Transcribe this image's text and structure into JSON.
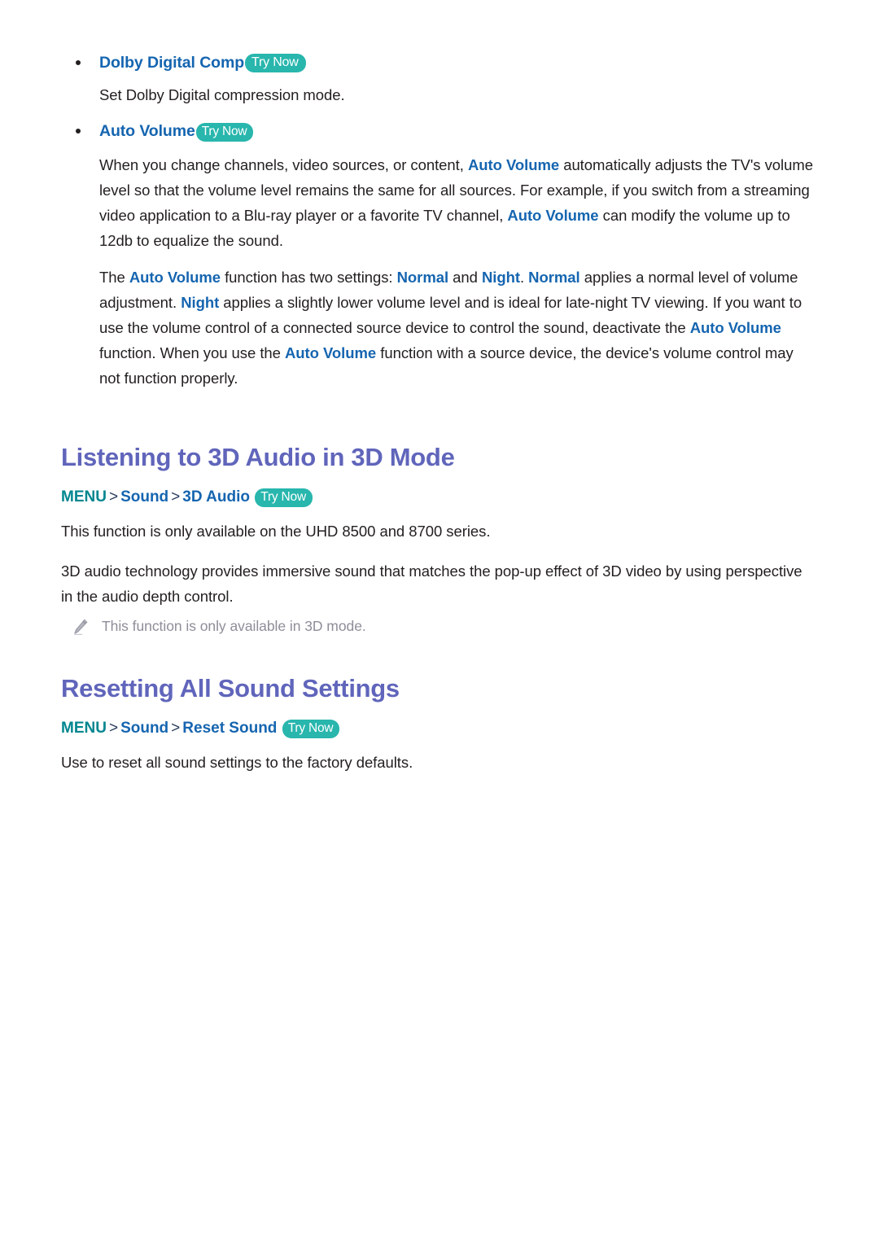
{
  "document": {
    "bullets": [
      {
        "title": "Dolby Digital Comp",
        "badge": "Try Now",
        "description": "Set Dolby Digital compression mode."
      },
      {
        "title": "Auto Volume",
        "badge": "Try Now"
      }
    ],
    "auto_volume_paragraphs": {
      "p1": {
        "seg1": "When you change channels, video sources, or content, ",
        "link1": "Auto Volume",
        "seg2": " automatically adjusts the TV's volume level so that the volume level remains the same for all sources. For example, if you switch from a streaming video application to a Blu-ray player or a favorite TV channel, ",
        "link2": "Auto Volume",
        "seg3": " can modify the volume up to 12db to equalize the sound."
      },
      "p2": {
        "seg1": "The ",
        "link1": "Auto Volume",
        "seg2": " function has two settings: ",
        "link2": "Normal",
        "seg3": " and ",
        "link3": "Night",
        "seg4": ". ",
        "link4": "Normal",
        "seg5": " applies a normal level of volume adjustment. ",
        "link5": "Night",
        "seg6": " applies a slightly lower volume level and is ideal for late-night TV viewing. If you want to use the volume control of a connected source device to control the sound, deactivate the ",
        "link6": "Auto Volume",
        "seg7": " function. When you use the ",
        "link7": "Auto Volume",
        "seg8": " function with a source device, the device's volume control may not function properly."
      }
    },
    "sections": [
      {
        "heading": "Listening to 3D Audio in 3D Mode",
        "menu_path": {
          "root": "MENU",
          "sep1": ">",
          "node1": "Sound",
          "sep2": ">",
          "node2": "3D Audio",
          "badge": "Try Now"
        },
        "paragraphs": [
          "This function is only available on the UHD 8500 and 8700 series.",
          "3D audio technology provides immersive sound that matches the pop-up effect of 3D video by using perspective in the audio depth control."
        ],
        "note": {
          "icon": "pencil-icon",
          "text": "This function is only available in 3D mode."
        }
      },
      {
        "heading": "Resetting All Sound Settings",
        "menu_path": {
          "root": "MENU",
          "sep1": ">",
          "node1": "Sound",
          "sep2": ">",
          "node2": "Reset Sound",
          "badge": "Try Now"
        },
        "paragraphs": [
          "Use to reset all sound settings to the factory defaults."
        ]
      }
    ],
    "colors": {
      "link_blue": "#1565b0",
      "heading_purple": "#6065bb",
      "badge_teal": "#28b6ad",
      "menu_root_teal": "#00868f",
      "body_text": "#231f20",
      "note_gray": "#8e8e9a"
    }
  }
}
